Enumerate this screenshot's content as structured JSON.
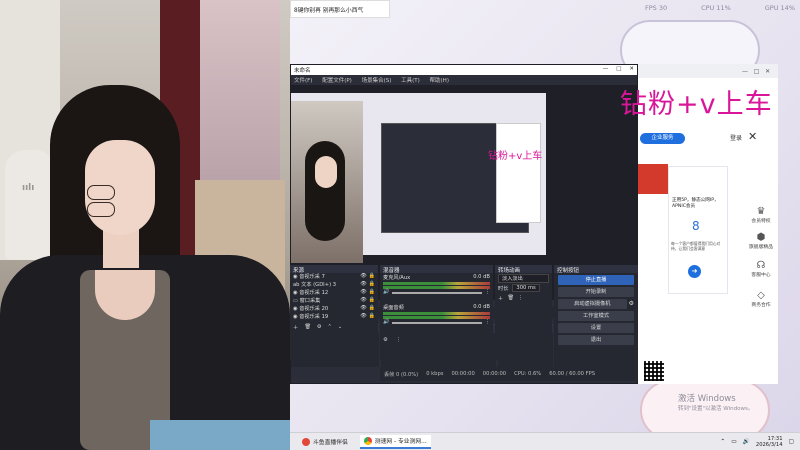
{
  "overlay_text": "钻粉+v上车",
  "preview_overlay_text": "钻粉+v上车",
  "notification": {
    "text": "8键你别再 别再那么小西气"
  },
  "fps_bar": {
    "fps_label": "FPS",
    "fps_value": "30",
    "cpu_label": "CPU",
    "cpu_value": "11%",
    "gpu_label": "GPU",
    "gpu_value": "14%"
  },
  "obs": {
    "window_title": "未命名",
    "menu": [
      "文件(F)",
      "配置文件(P)",
      "场景集合(S)",
      "工具(T)",
      "帮助(H)"
    ],
    "toolbar": {
      "settings": "设置",
      "filters": "滤镜"
    },
    "sources_dock": {
      "title": "来源",
      "items": [
        {
          "label": "音视乐采 7"
        },
        {
          "label": "文本 (GDI+) 3"
        },
        {
          "label": "音视乐采 12"
        },
        {
          "label": "窗口采集"
        },
        {
          "label": "音视乐采 20"
        },
        {
          "label": "音视乐采 19"
        }
      ]
    },
    "mixer_dock": {
      "title": "混音器",
      "channels": [
        {
          "name": "麦克风/Aux",
          "db": "0.0 dB"
        },
        {
          "name": "桌面音频",
          "db": "0.0 dB"
        }
      ]
    },
    "transitions_dock": {
      "title": "转场动画",
      "type": "淡入淡出",
      "duration_label": "时长",
      "duration_value": "300 ms"
    },
    "controls_dock": {
      "title": "控制按钮",
      "buttons": [
        "停止直播",
        "开始录制",
        "启动虚拟摄像机",
        "工作室模式",
        "设置",
        "退出"
      ]
    },
    "status": {
      "frames": "丢帧 0 (0.0%)",
      "kbps": "0 kbps",
      "time1": "00:00:00",
      "time2": "00:00:00",
      "cpu": "CPU: 0.6%",
      "fps": "60.00 / 60.00 FPS"
    }
  },
  "right_app": {
    "service_button": "企业服务",
    "login": "登录",
    "ad": {
      "line1": "正用5P，静态公网IP，APNIC会员",
      "number": "8",
      "sub": "每一个客户都值得我们用心对待，让我们会客满意"
    },
    "side": [
      {
        "icon": "crown-icon",
        "label": "会员特权"
      },
      {
        "icon": "cube-icon",
        "label": "旗舰版精品"
      },
      {
        "icon": "headset-icon",
        "label": "客服中心"
      },
      {
        "icon": "diamond-icon",
        "label": "商务合作"
      }
    ]
  },
  "activate_windows": {
    "title": "激活 Windows",
    "subtitle": "转到\"设置\"以激活 Windows。"
  },
  "taskbar": {
    "items": [
      {
        "label": "斗鱼直播伴侣"
      },
      {
        "label": "测速网 - 专业测网..."
      }
    ],
    "time": "17:31",
    "date": "2026/3/14"
  }
}
